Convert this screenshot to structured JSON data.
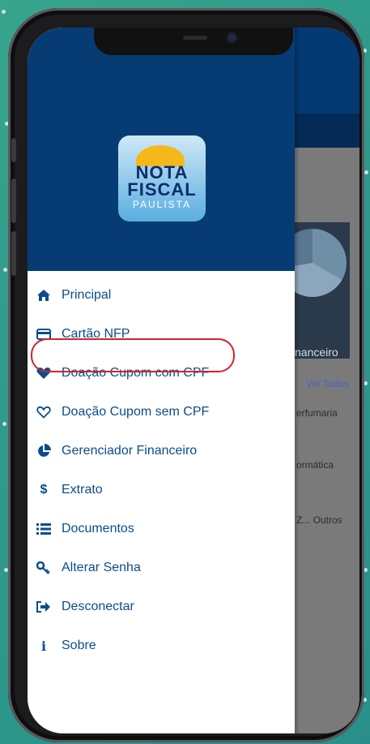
{
  "logo": {
    "line1": "NOTA",
    "line2": "FISCAL",
    "line3": "PAULISTA"
  },
  "menu": {
    "items": [
      {
        "label": "Principal",
        "icon": "home-icon"
      },
      {
        "label": "Cartão NFP",
        "icon": "credit-card-icon"
      },
      {
        "label": "Doação Cupom com CPF",
        "icon": "heart-filled-icon",
        "highlighted": true
      },
      {
        "label": "Doação Cupom sem CPF",
        "icon": "heart-outline-icon"
      },
      {
        "label": "Gerenciador Financeiro",
        "icon": "pie-chart-icon"
      },
      {
        "label": "Extrato",
        "icon": "dollar-icon"
      },
      {
        "label": "Documentos",
        "icon": "list-icon"
      },
      {
        "label": "Alterar Senha",
        "icon": "key-icon"
      },
      {
        "label": "Desconectar",
        "icon": "sign-out-icon"
      },
      {
        "label": "Sobre",
        "icon": "info-icon"
      }
    ]
  },
  "background": {
    "card_label": "nanceiro",
    "see_all": "Ver Todos",
    "list": [
      "erfumaria",
      "ormática",
      "Z... Outros"
    ]
  },
  "colors": {
    "header_blue": "#063c73",
    "menu_text": "#0b4d8c",
    "highlight_red": "#d2232a"
  }
}
